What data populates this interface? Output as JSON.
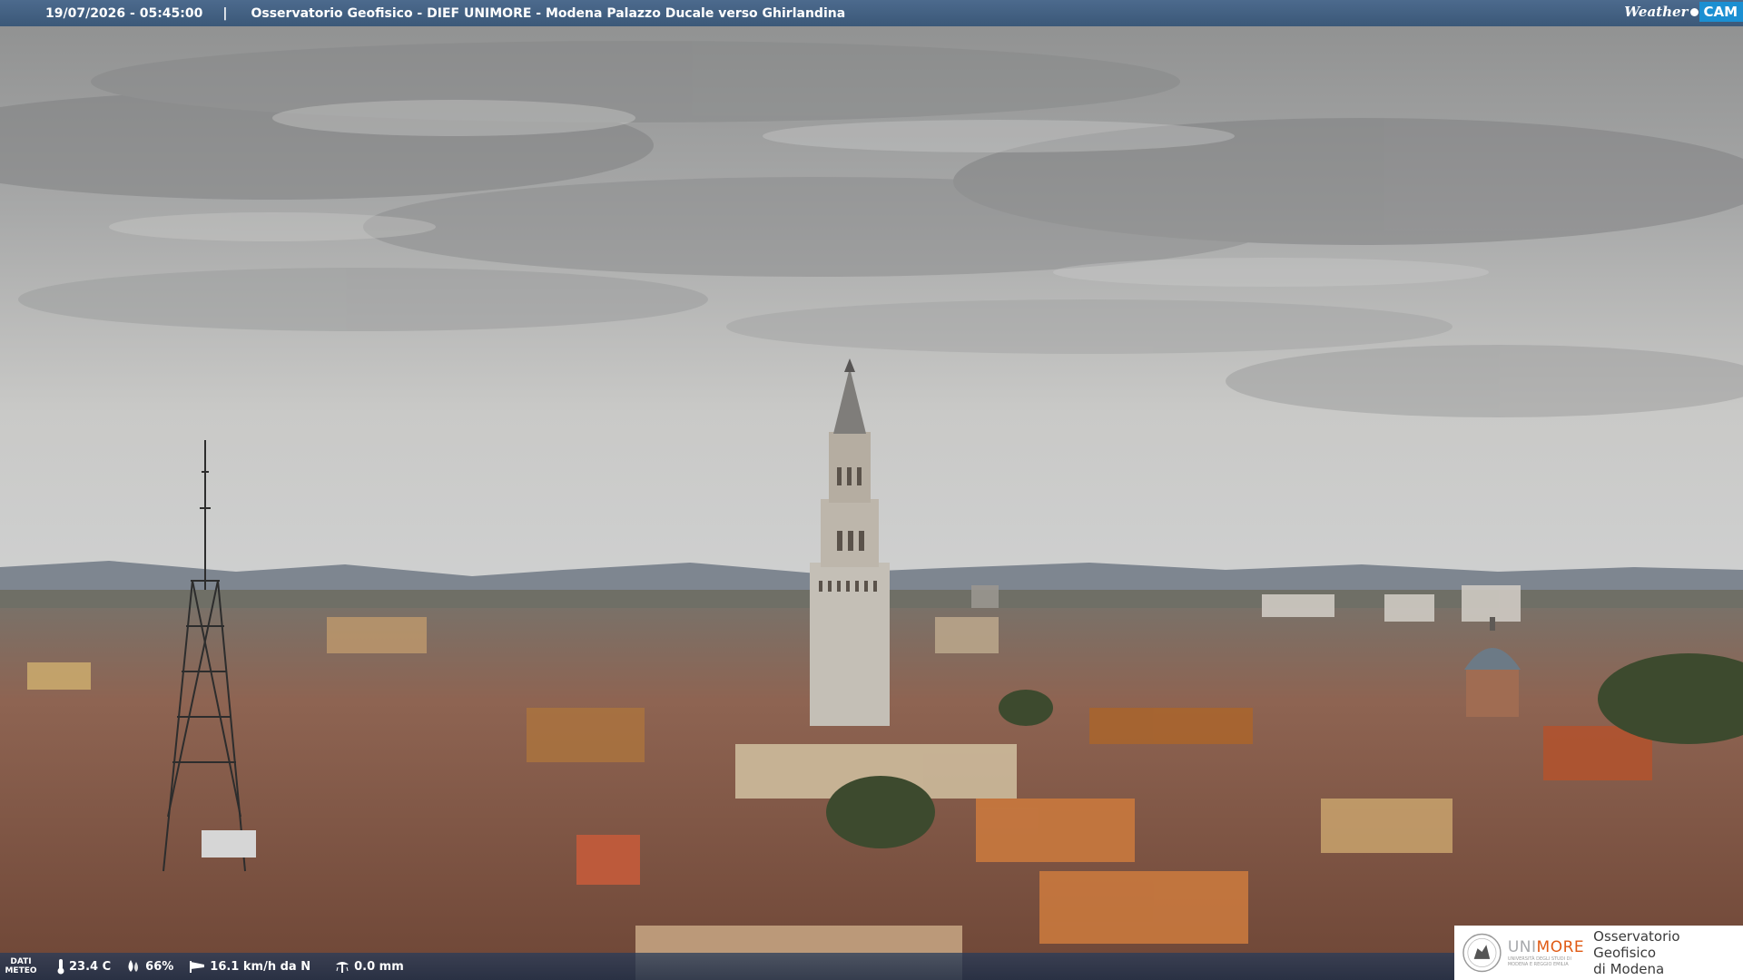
{
  "header": {
    "datetime": "19/07/2026 - 05:45:00",
    "separator": "|",
    "title": "Osservatorio Geofisico - DIEF UNIMORE - Modena Palazzo Ducale verso Ghirlandina",
    "logo_weather": "Weather",
    "logo_cam": "CAM"
  },
  "meteo": {
    "label_line1": "DATI",
    "label_line2": "METEO",
    "temperature": "23.4 C",
    "humidity": "66%",
    "wind": "16.1 km/h da N",
    "rain": "0.0 mm",
    "icons": [
      "thermometer-icon",
      "humidity-drop-icon",
      "wind-sock-icon",
      "rain-gauge-icon"
    ]
  },
  "sponsor": {
    "uni_prefix": "UNI",
    "uni_suffix": "MORE",
    "uni_sub1": "UNIVERSITÀ DEGLI STUDI DI",
    "uni_sub2": "MODENA E REGGIO EMILIA",
    "obs_line1": "Osservatorio Geofisico",
    "obs_line2": "di Modena"
  },
  "colors": {
    "topbar": "#3f5d80",
    "weathercam_blue": "#1b8fd2",
    "unimore_orange": "#e05a14",
    "sky": "#b8b8b6",
    "roofs": "#8a5a43"
  }
}
